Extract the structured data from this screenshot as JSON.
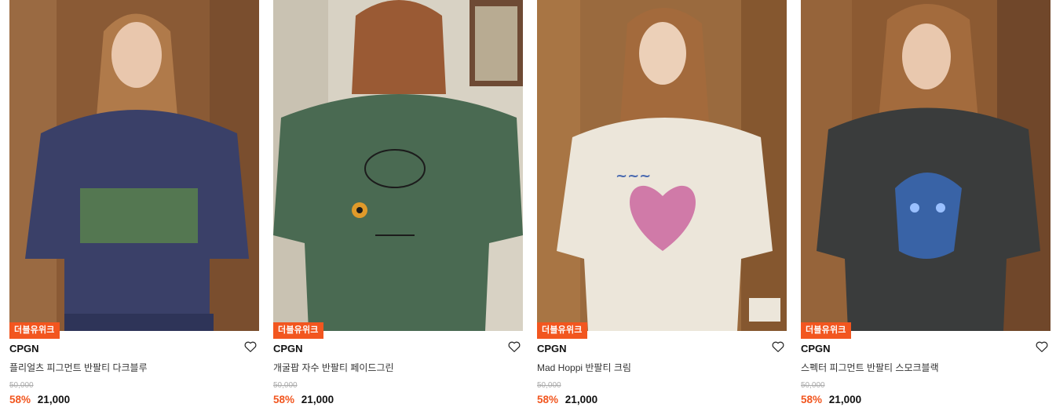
{
  "colors": {
    "accent": "#f2561f",
    "badge_text": "#ffffff"
  },
  "products": [
    {
      "badge": "더블유위크",
      "brand": "CPGN",
      "name": "플리얼츠 피그먼트 반팔티 다크블루",
      "original_price": "50,000",
      "discount": "58%",
      "price": "21,000",
      "icon": "heart-outline-icon"
    },
    {
      "badge": "더블유위크",
      "brand": "CPGN",
      "name": "개굴팝 자수 반팔티 페이드그린",
      "original_price": "50,000",
      "discount": "58%",
      "price": "21,000",
      "icon": "heart-outline-icon"
    },
    {
      "badge": "더블유위크",
      "brand": "CPGN",
      "name": "Mad Hoppi 반팔티 크림",
      "original_price": "50,000",
      "discount": "58%",
      "price": "21,000",
      "icon": "heart-outline-icon"
    },
    {
      "badge": "더블유위크",
      "brand": "CPGN",
      "name": "스펙터 피그먼트 반팔티 스모크블랙",
      "original_price": "50,000",
      "discount": "58%",
      "price": "21,000",
      "icon": "heart-outline-icon"
    }
  ]
}
